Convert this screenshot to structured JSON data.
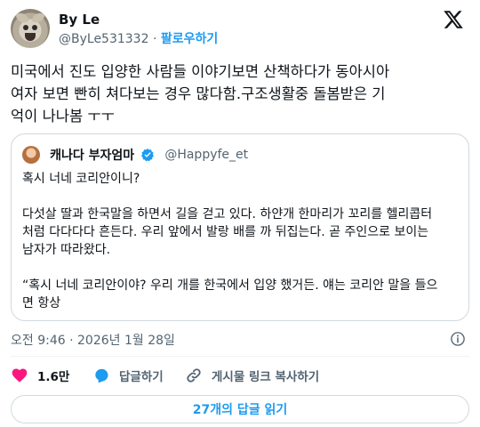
{
  "author": {
    "display_name": "By Le",
    "handle": "@ByLe531332",
    "separator": "·",
    "follow_label": "팔로우하기"
  },
  "tweet": {
    "lines": [
      "미국에서 진도 입양한 사람들 이야기보면 산책하다가 동아시아",
      "여자 보면 빤히 쳐다보는 경우 많다함.구조생활중 돌봄받은 기",
      "억이 나나봄 ㅜㅜ"
    ]
  },
  "quote": {
    "display_name": "캐나다 부자엄마",
    "handle": "@Happyfe_et",
    "paragraphs": [
      [
        "혹시 너네 코리안이니?"
      ],
      [
        "다섯살 딸과 한국말을 하면서 길을 걷고 있다. 하얀개 한마리가 꼬리를 헬리콥터",
        "처럼 다다다다 흔든다. 우리 앞에서 발랑 배를 까 뒤집는다. 곧 주인으로 보이는",
        "남자가 따라왔다."
      ],
      [
        "“혹시 너네 코리안이야? 우리 개를 한국에서 입양 했거든. 얘는 코리안 말을 들으",
        "면 항상"
      ]
    ]
  },
  "meta": {
    "timestamp": "오전 9:46 · 2026년 1월 28일"
  },
  "actions": {
    "likes_count": "1.6만",
    "reply_label": "답글하기",
    "copy_link_label": "게시물 링크 복사하기"
  },
  "replies_button": {
    "label": "27개의 답글 읽기"
  },
  "colors": {
    "accent": "#1d9bf0",
    "like": "#f91880",
    "text": "#0f1419",
    "secondary": "#536471",
    "border": "#cfd9de"
  },
  "icons": [
    "x-logo-icon",
    "verified-badge-icon",
    "info-icon",
    "heart-icon",
    "reply-bubble-icon",
    "link-icon"
  ]
}
